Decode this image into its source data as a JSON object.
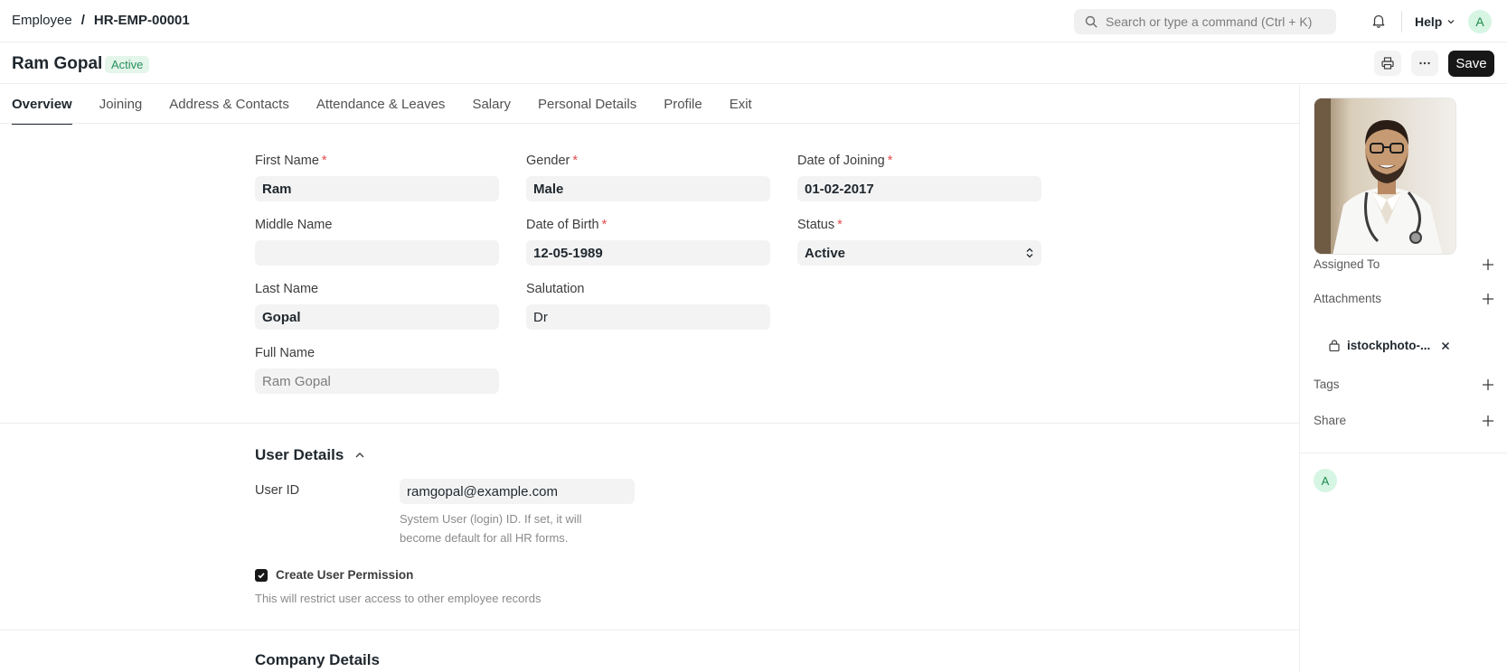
{
  "navbar": {
    "breadcrumb_root": "Employee",
    "breadcrumb_sep": "/",
    "breadcrumb_current": "HR-EMP-00001",
    "search_placeholder": "Search or type a command (Ctrl + K)",
    "help_label": "Help",
    "avatar_initial": "A"
  },
  "titlebar": {
    "title": "Ram Gopal",
    "status": "Active",
    "save_label": "Save"
  },
  "tabs": [
    "Overview",
    "Joining",
    "Address & Contacts",
    "Attendance & Leaves",
    "Salary",
    "Personal Details",
    "Profile",
    "Exit"
  ],
  "active_tab": "Overview",
  "form": {
    "first_name": {
      "label": "First Name",
      "required": "*",
      "value": "Ram"
    },
    "middle_name": {
      "label": "Middle Name",
      "value": ""
    },
    "last_name": {
      "label": "Last Name",
      "value": "Gopal"
    },
    "full_name": {
      "label": "Full Name",
      "value": "Ram Gopal"
    },
    "gender": {
      "label": "Gender",
      "required": "*",
      "value": "Male"
    },
    "date_of_birth": {
      "label": "Date of Birth",
      "required": "*",
      "value": "12-05-1989"
    },
    "salutation": {
      "label": "Salutation",
      "value": "Dr"
    },
    "date_of_joining": {
      "label": "Date of Joining",
      "required": "*",
      "value": "01-02-2017"
    },
    "status": {
      "label": "Status",
      "required": "*",
      "value": "Active"
    }
  },
  "user_details": {
    "section_title": "User Details",
    "user_id_label": "User ID",
    "user_id_value": "ramgopal@example.com",
    "user_id_description": "System User (login) ID. If set, it will become default for all HR forms.",
    "create_permission_label": "Create User Permission",
    "create_permission_checked": true,
    "create_permission_description": "This will restrict user access to other employee records"
  },
  "company_details": {
    "section_title": "Company Details"
  },
  "sidebar": {
    "assigned_to": "Assigned To",
    "attachments": "Attachments",
    "attachment_file": "istockphoto-...",
    "tags": "Tags",
    "share": "Share",
    "viewer_initial": "A"
  },
  "colors": {
    "accent": "#171717",
    "status_bg": "#e4f5e9",
    "status_text": "#278f5e",
    "required": "#e24c4c"
  }
}
